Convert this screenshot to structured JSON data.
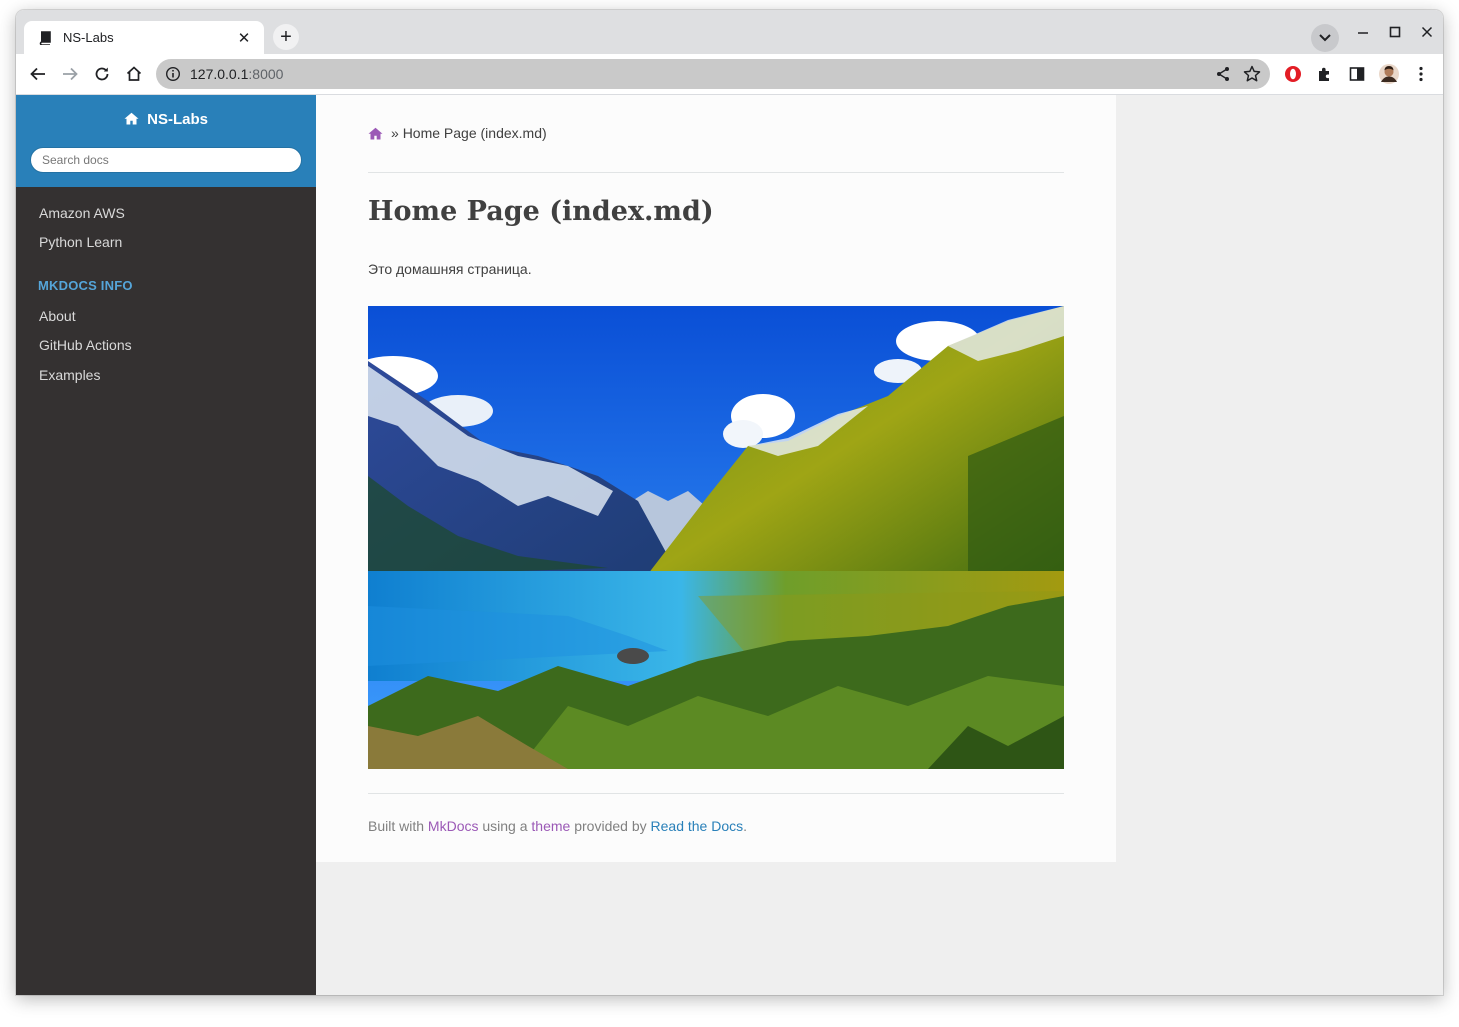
{
  "browser": {
    "tab_title": "NS-Labs",
    "url_host": "127.0.0.1",
    "url_port": ":8000"
  },
  "sidebar": {
    "brand": "NS-Labs",
    "search_placeholder": "Search docs",
    "items_top": [
      "Amazon AWS",
      "Python Learn"
    ],
    "caption": "MKDOCS INFO",
    "items_info": [
      "About",
      "GitHub Actions",
      "Examples"
    ]
  },
  "main": {
    "breadcrumb_sep": "»",
    "breadcrumb_current": "Home Page (index.md)",
    "title": "Home Page (index.md)",
    "paragraph": "Это домашняя страница."
  },
  "footer": {
    "built_with": "Built with ",
    "mkdocs": "MkDocs",
    "using_a": " using a ",
    "theme": "theme",
    "provided_by": " provided by ",
    "rtd": "Read the Docs",
    "period": "."
  },
  "colors": {
    "sidebar_bg": "#343131",
    "sidebar_header": "#2980b9",
    "caption": "#55a5d9",
    "link_purple": "#9b59b6",
    "link_blue": "#2980b9"
  }
}
